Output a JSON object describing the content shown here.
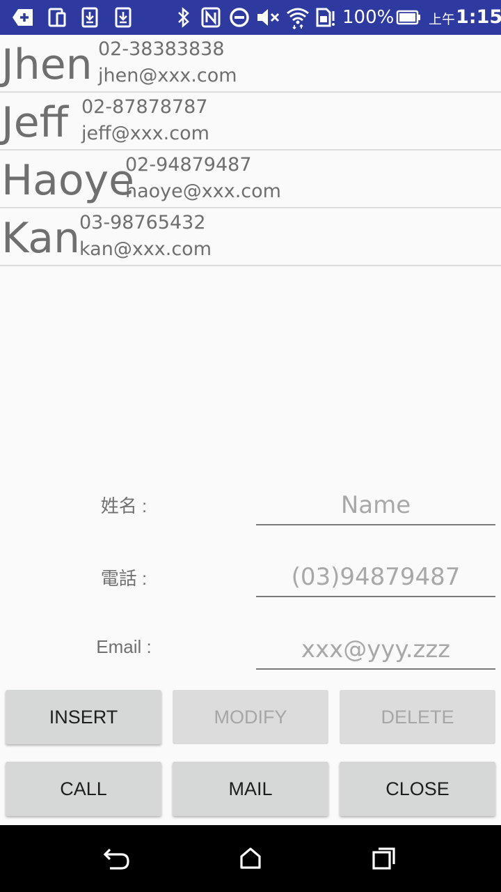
{
  "status_bar": {
    "battery_percent": "100%",
    "time_prefix": "上午",
    "time": "1:15",
    "icons": [
      "add-box-icon",
      "phone-tablet-icon",
      "download-icon",
      "download-icon",
      "bluetooth-icon",
      "nfc-icon",
      "do-not-disturb-icon",
      "mute-icon",
      "wifi-icon",
      "sim-alert-icon",
      "battery-icon"
    ]
  },
  "contacts": [
    {
      "name": "Jhen",
      "phone": "02-38383838",
      "email": "jhen@xxx.com"
    },
    {
      "name": "Jeff",
      "phone": "02-87878787",
      "email": "jeff@xxx.com"
    },
    {
      "name": "Haoye",
      "phone": "02-94879487",
      "email": "haoye@xxx.com"
    },
    {
      "name": "Kan",
      "phone": "03-98765432",
      "email": "kan@xxx.com"
    }
  ],
  "form": {
    "name_label": "姓名 :",
    "name_placeholder": "Name",
    "phone_label": "電話 :",
    "phone_placeholder": "(03)94879487",
    "email_label": "Email :",
    "email_placeholder": "xxx@yyy.zzz"
  },
  "buttons": {
    "insert": "INSERT",
    "modify": "MODIFY",
    "delete": "DELETE",
    "call": "CALL",
    "mail": "MAIL",
    "close": "CLOSE"
  },
  "colors": {
    "status_bar": "#2f3aa0",
    "button_bg": "#d6d7d7",
    "disabled_text": "#a6a6a6"
  }
}
